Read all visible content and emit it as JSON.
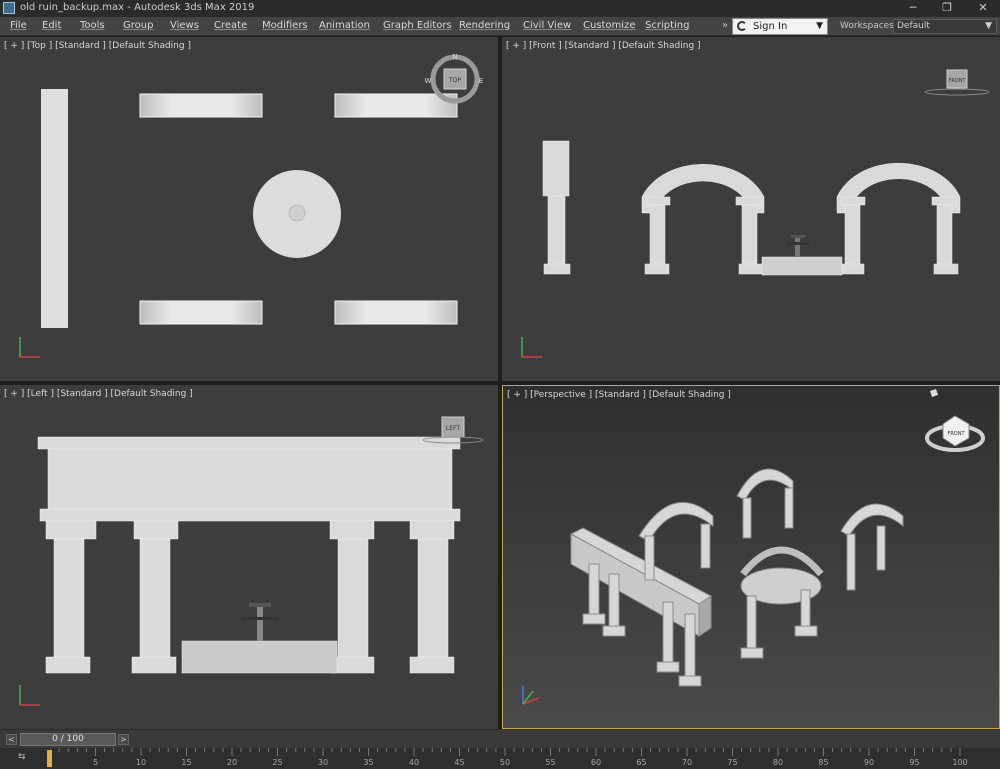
{
  "window": {
    "title": "old ruin_backup.max - Autodesk 3ds Max 2019",
    "minimize": "─",
    "maximize": "❐",
    "close": "✕"
  },
  "menu": {
    "items": [
      "File",
      "Edit",
      "Tools",
      "Group",
      "Views",
      "Create",
      "Modifiers",
      "Animation",
      "Graph Editors",
      "Rendering",
      "Civil View",
      "Customize",
      "Scripting"
    ],
    "more": "»",
    "sign_in": "Sign In",
    "workspaces_label": "Workspaces:",
    "workspaces_value": "Default"
  },
  "viewports": {
    "top": {
      "label": "[ + ] [Top ] [Standard ] [Default Shading ]",
      "cube_text": "TOP",
      "compass": [
        "N",
        "W",
        "E"
      ]
    },
    "front": {
      "label": "[ + ] [Front ] [Standard ] [Default Shading ]",
      "cube_text": "FRONT"
    },
    "left": {
      "label": "[ + ] [Left ] [Standard ] [Default Shading ]",
      "cube_text": "LEFT"
    },
    "perspective": {
      "label": "[ + ] [Perspective ] [Standard ] [Default Shading ]",
      "cube_text": "FRONT"
    }
  },
  "timeline": {
    "slider": "0 / 100",
    "prev": "<",
    "next": ">",
    "track_icon": "⇆",
    "ticks": [
      "0",
      "5",
      "10",
      "15",
      "20",
      "25",
      "30",
      "35",
      "40",
      "45",
      "50",
      "55",
      "60",
      "65",
      "70",
      "75",
      "80",
      "85",
      "90",
      "95",
      "100"
    ]
  },
  "colors": {
    "active_viewport_border": "#c8a84a",
    "viewport_bg": "#3d3d3d",
    "geometry": "#d8d8d8"
  }
}
